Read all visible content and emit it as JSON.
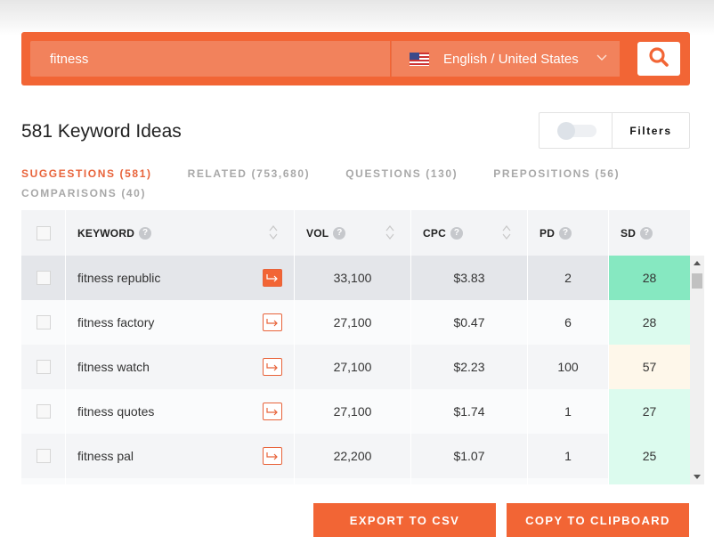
{
  "search": {
    "query": "fitness",
    "language": "English / United States",
    "language_flag": "us-flag-icon"
  },
  "header": {
    "title": "581 Keyword Ideas",
    "filters_label": "Filters",
    "filter_toggle_on": false
  },
  "tabs": [
    {
      "label": "SUGGESTIONS (581)",
      "active": true
    },
    {
      "label": "RELATED (753,680)",
      "active": false
    },
    {
      "label": "QUESTIONS (130)",
      "active": false
    },
    {
      "label": "PREPOSITIONS (56)",
      "active": false
    },
    {
      "label": "COMPARISONS (40)",
      "active": false
    }
  ],
  "table": {
    "columns": {
      "keyword": "KEYWORD",
      "vol": "VOL",
      "cpc": "CPC",
      "pd": "PD",
      "sd": "SD"
    },
    "help_glyph": "?",
    "rows": [
      {
        "keyword": "fitness republic",
        "vol": "33,100",
        "cpc": "$3.83",
        "pd": "2",
        "sd": "28",
        "sd_color": "#86e8c1"
      },
      {
        "keyword": "fitness factory",
        "vol": "27,100",
        "cpc": "$0.47",
        "pd": "6",
        "sd": "28",
        "sd_color": "#dcfbee"
      },
      {
        "keyword": "fitness watch",
        "vol": "27,100",
        "cpc": "$2.23",
        "pd": "100",
        "sd": "57",
        "sd_color": "#fef7ea"
      },
      {
        "keyword": "fitness quotes",
        "vol": "27,100",
        "cpc": "$1.74",
        "pd": "1",
        "sd": "27",
        "sd_color": "#dcfbee"
      },
      {
        "keyword": "fitness pal",
        "vol": "22,200",
        "cpc": "$1.07",
        "pd": "1",
        "sd": "25",
        "sd_color": "#dcfbee"
      }
    ]
  },
  "actions": {
    "export_label": "EXPORT TO CSV",
    "copy_label": "COPY TO CLIPBOARD"
  },
  "colors": {
    "brand": "#f26535",
    "brand_light": "#f2825c",
    "active_tab": "#e8633a"
  }
}
